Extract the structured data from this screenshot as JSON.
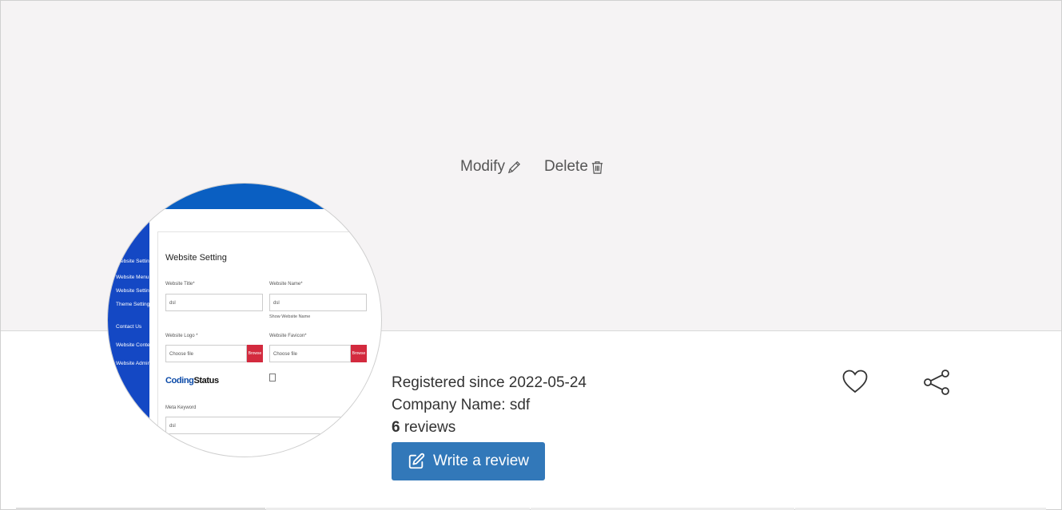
{
  "cover": {
    "modify_label": "Modify",
    "delete_label": "Delete"
  },
  "avatar_preview": {
    "page_title": "Website Setting",
    "sidebar_items": [
      "Website Setting",
      "Website Menu",
      "Website Setting",
      "Theme Setting",
      "Contact Us",
      "Website Content",
      "Website Admin"
    ],
    "field_website_title_label": "Website Title*",
    "field_website_title_value": "dsl",
    "field_website_name_label": "Website Name*",
    "field_website_name_value": "dsl",
    "show_website_name": "Show Website Name",
    "field_logo_label": "Website Logo *",
    "field_favicon_label": "Website Favicon*",
    "choose_file": "Choose file",
    "browse": "Browse",
    "logo_text_a": "Coding",
    "logo_text_b": "Status",
    "meta_keyword_label": "Meta Keyword",
    "meta_keyword_value": "dsl"
  },
  "profile": {
    "registered": "Registered since 2022-05-24",
    "company": "Company Name: sdf",
    "review_count": "6",
    "reviews_word": "reviews",
    "write_review_label": "Write a review"
  },
  "colors": {
    "button_blue": "#3278b9",
    "cover_bg": "#f5f3f4"
  },
  "icons": [
    "pencil-icon",
    "trash-icon",
    "edit-square-icon",
    "heart-icon",
    "share-icon"
  ]
}
